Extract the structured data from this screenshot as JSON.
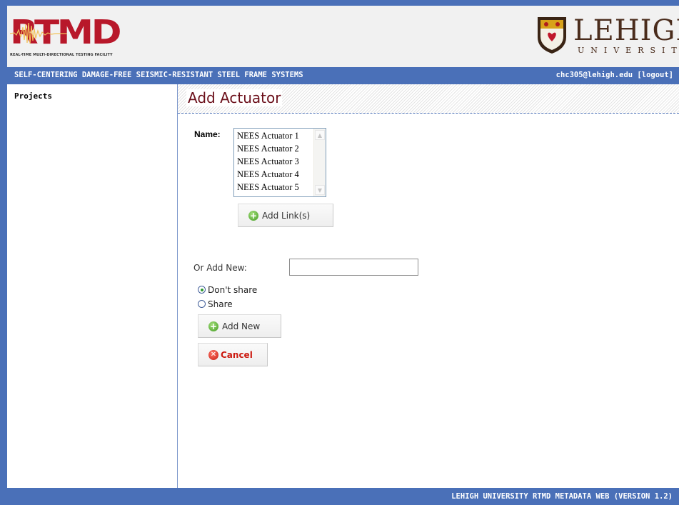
{
  "header": {
    "rtmd_logo_text": "RTMD",
    "rtmd_tagline": "REAL-TIME MULTI-DIRECTIONAL TESTING FACILITY",
    "lehigh_logo_text": "LEHIGH",
    "lehigh_sub_text": "UNIVERSITY"
  },
  "titlebar": {
    "project_name": "SELF-CENTERING DAMAGE-FREE SEISMIC-RESISTANT STEEL FRAME SYSTEMS",
    "user_email": "chc305@lehigh.edu",
    "logout_label": "[logout]"
  },
  "sidebar": {
    "items": [
      {
        "label": "Projects"
      }
    ]
  },
  "main": {
    "page_title": "Add Actuator",
    "name_label": "Name:",
    "actuator_options": [
      "NEES Actuator 1",
      "NEES Actuator 2",
      "NEES Actuator 3",
      "NEES Actuator 4",
      "NEES Actuator 5"
    ],
    "add_links_label": "Add Link(s)",
    "or_add_new_label": "Or Add New:",
    "new_name_value": "",
    "share_options": [
      {
        "label": "Don't share",
        "checked": true
      },
      {
        "label": "Share",
        "checked": false
      }
    ],
    "add_new_label": "Add New",
    "cancel_label": "Cancel"
  },
  "footer": {
    "text": "LEHIGH UNIVERSITY RTMD METADATA WEB (VERSION 1.2)"
  },
  "colors": {
    "accent_blue": "#4a70b8",
    "title_red": "#6b0f1a",
    "cancel_red": "#cc1a10"
  }
}
